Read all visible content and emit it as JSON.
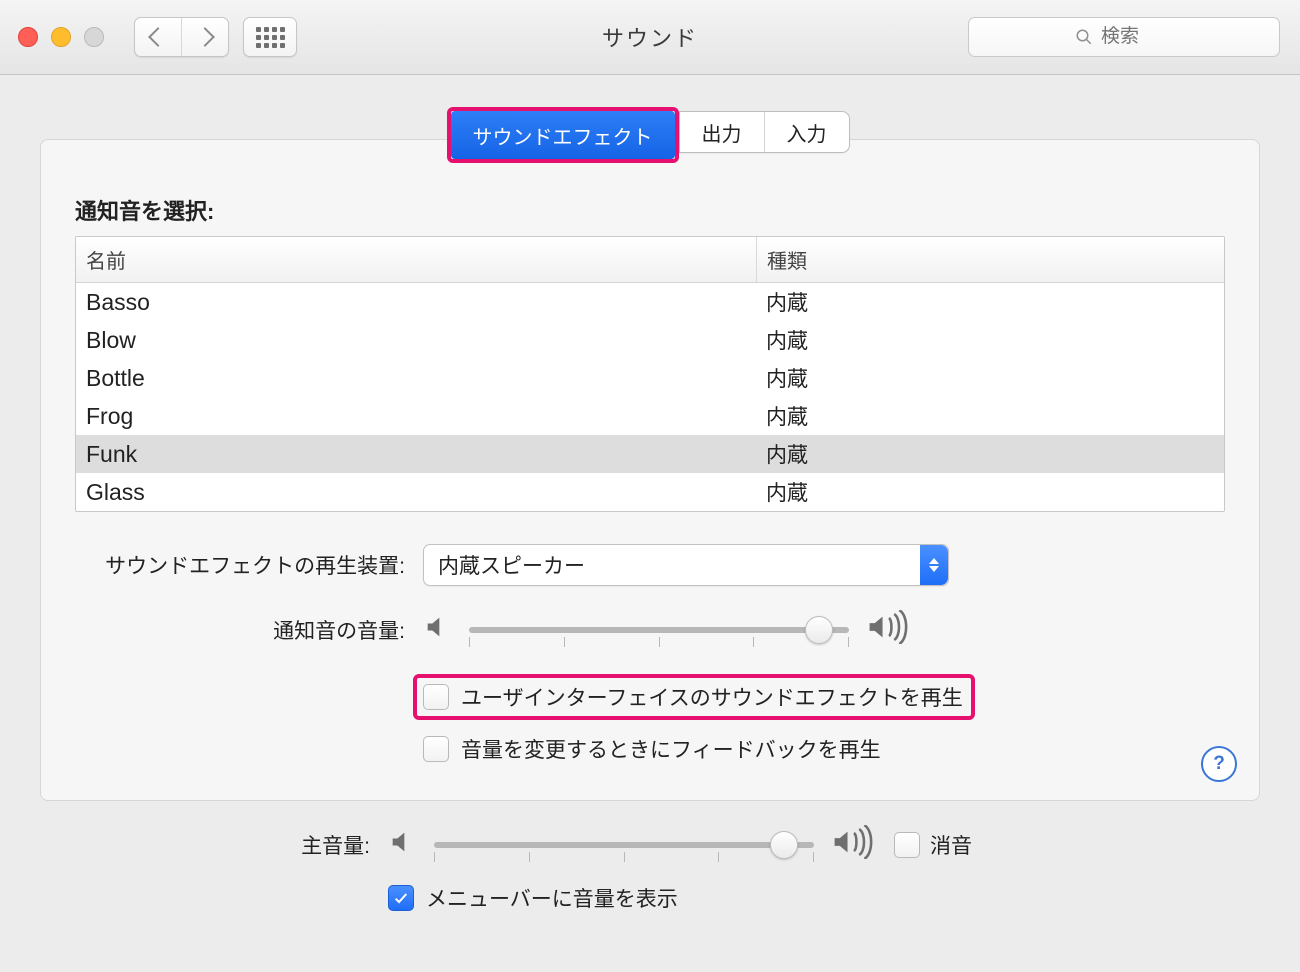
{
  "window": {
    "title": "サウンド"
  },
  "search": {
    "placeholder": "検索"
  },
  "tabs": {
    "effects": "サウンドエフェクト",
    "output": "出力",
    "input": "入力",
    "active": "effects"
  },
  "section": {
    "select_alert_label": "通知音を選択:"
  },
  "table": {
    "columns": {
      "name": "名前",
      "kind": "種類"
    },
    "rows": [
      {
        "name": "Basso",
        "kind": "内蔵",
        "selected": false
      },
      {
        "name": "Blow",
        "kind": "内蔵",
        "selected": false
      },
      {
        "name": "Bottle",
        "kind": "内蔵",
        "selected": false
      },
      {
        "name": "Frog",
        "kind": "内蔵",
        "selected": false
      },
      {
        "name": "Funk",
        "kind": "内蔵",
        "selected": true
      },
      {
        "name": "Glass",
        "kind": "内蔵",
        "selected": false
      }
    ]
  },
  "device": {
    "label": "サウンドエフェクトの再生装置:",
    "value": "内蔵スピーカー"
  },
  "alert_volume": {
    "label": "通知音の音量:",
    "value_pct": 92
  },
  "checkboxes": {
    "ui_sound": {
      "label": "ユーザインターフェイスのサウンドエフェクトを再生",
      "checked": false
    },
    "feedback": {
      "label": "音量を変更するときにフィードバックを再生",
      "checked": false
    },
    "menubar": {
      "label": "メニューバーに音量を表示",
      "checked": true
    }
  },
  "main_volume": {
    "label": "主音量:",
    "value_pct": 92,
    "mute_label": "消音",
    "mute_checked": false
  },
  "help": {
    "glyph": "?"
  },
  "colors": {
    "accent": "#2d7ef7",
    "highlight": "#e6116e"
  }
}
